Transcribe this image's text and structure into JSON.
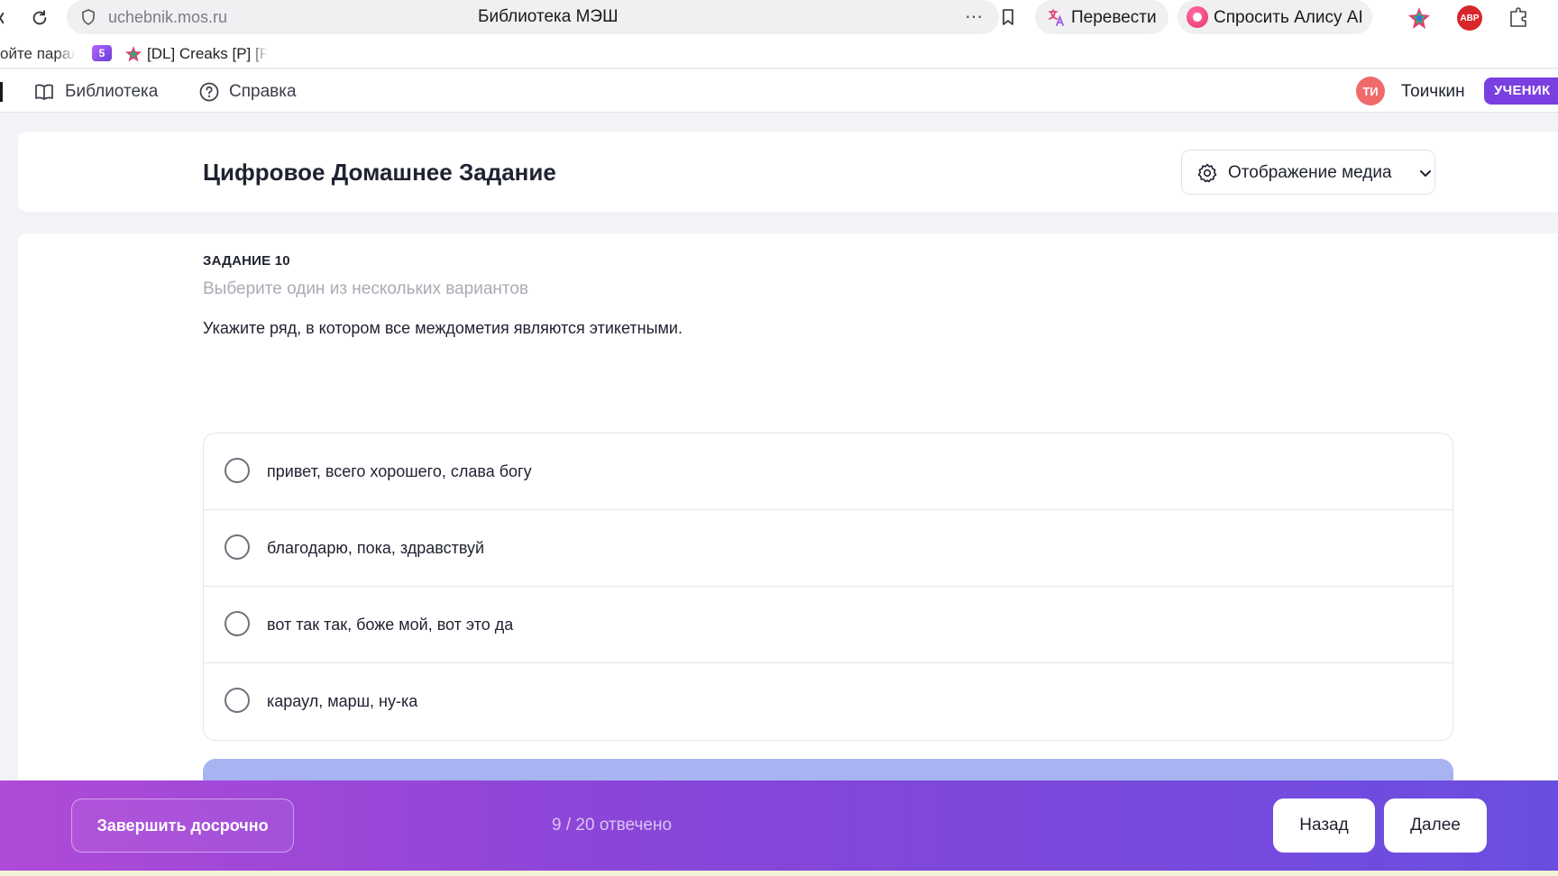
{
  "browser": {
    "url": "uchebnik.mos.ru",
    "page_title": "Библиотека МЭШ",
    "more_icon": "⋯",
    "translate_label": "Перевести",
    "alice_label": "Спросить Алису AI",
    "abp_label": "ABP"
  },
  "bookmarks": {
    "item_cut": "ойте парал",
    "five_badge": "5",
    "dl_label": "[DL] Creaks [P] [R"
  },
  "header": {
    "library_label": "Библиотека",
    "help_label": "Справка",
    "avatar_initials": "ТИ",
    "user_name": "Тоичкин",
    "role_badge": "УЧЕНИК"
  },
  "title_card": {
    "title": "Цифровое Домашнее Задание",
    "media_button": "Отображение медиа"
  },
  "task": {
    "number": "ЗАДАНИЕ 10",
    "hint": "Выберите один из нескольких вариантов",
    "question": "Укажите ряд, в котором все междометия являются этикетными.",
    "options": [
      {
        "label": "привет, всего хорошего, слава богу",
        "selected": false
      },
      {
        "label": "благодарю, пока, здравствуй",
        "selected": false
      },
      {
        "label": "вот так так, боже мой, вот это да",
        "selected": false
      },
      {
        "label": "караул, марш, ну-ка",
        "selected": false
      }
    ]
  },
  "footer": {
    "finish_label": "Завершить досрочно",
    "progress_text": "9 / 20 отвечено",
    "back_label": "Назад",
    "next_label": "Далее"
  },
  "colors": {
    "accent_purple": "#7a3fe0",
    "footer_gradient_start": "#b04ad8",
    "footer_gradient_end": "#6a4ee0",
    "avatar": "#f06a6a",
    "submit_peek": "#a8b4f2"
  }
}
